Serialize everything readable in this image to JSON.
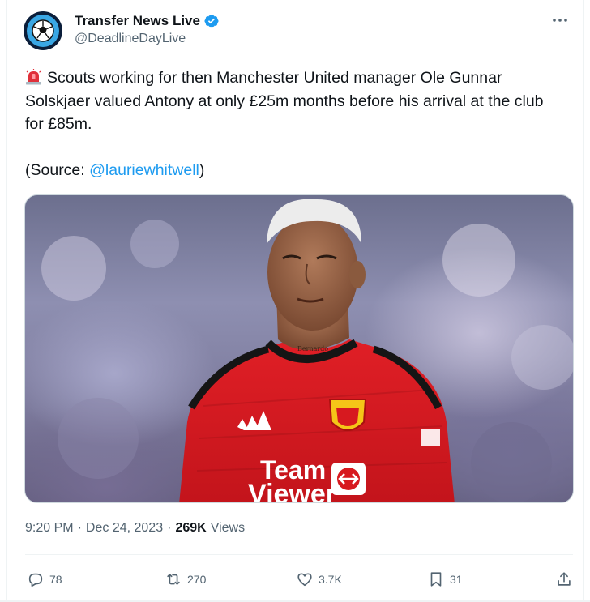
{
  "author": {
    "display_name": "Transfer News Live",
    "handle": "@DeadlineDayLive",
    "verified": true,
    "avatar_icon": "football-icon"
  },
  "tweet": {
    "text": "Scouts working for then Manchester United manager Ole Gunnar Solskjaer valued Antony at only £25m months before his arrival at the club for £85m.",
    "source_prefix": "(Source: ",
    "source_mention": "@lauriewhitwell",
    "source_suffix": ")",
    "leading_emoji": "siren-icon"
  },
  "media": {
    "shirt_sponsor_line1": "Team",
    "shirt_sponsor_line2": "Viewer",
    "tattoo_text": "Bernardo"
  },
  "meta": {
    "time": "9:20 PM",
    "separator": "·",
    "date": "Dec 24, 2023",
    "views_count": "269K",
    "views_label": "Views"
  },
  "actions": {
    "replies": "78",
    "reposts": "270",
    "likes": "3.7K",
    "bookmarks": "31"
  },
  "colors": {
    "accent": "#1d9bf0",
    "secondary_text": "#536471",
    "jersey_red": "#d7191f"
  }
}
